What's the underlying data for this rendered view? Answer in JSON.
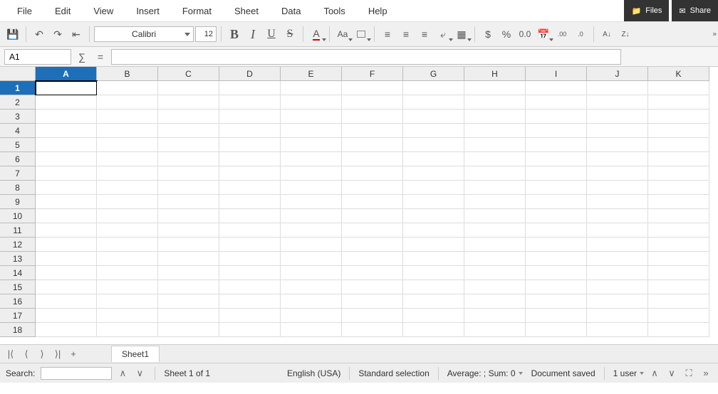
{
  "menu": [
    "File",
    "Edit",
    "View",
    "Insert",
    "Format",
    "Sheet",
    "Data",
    "Tools",
    "Help"
  ],
  "topButtons": {
    "files": "Files",
    "share": "Share"
  },
  "toolbar": {
    "fontName": "Calibri",
    "fontSize": "12"
  },
  "formulaBar": {
    "nameBox": "A1",
    "formula": ""
  },
  "columns": [
    "A",
    "B",
    "C",
    "D",
    "E",
    "F",
    "G",
    "H",
    "I",
    "J",
    "K"
  ],
  "rows": [
    1,
    2,
    3,
    4,
    5,
    6,
    7,
    8,
    9,
    10,
    11,
    12,
    13,
    14,
    15,
    16,
    17,
    18
  ],
  "activeCol": "A",
  "activeRow": 1,
  "sheetTab": "Sheet1",
  "statusBar": {
    "searchLabel": "Search:",
    "sheetInfo": "Sheet 1 of 1",
    "language": "English (USA)",
    "selectionMode": "Standard selection",
    "stats": "Average: ; Sum: 0",
    "saveStatus": "Document saved",
    "users": "1 user"
  }
}
